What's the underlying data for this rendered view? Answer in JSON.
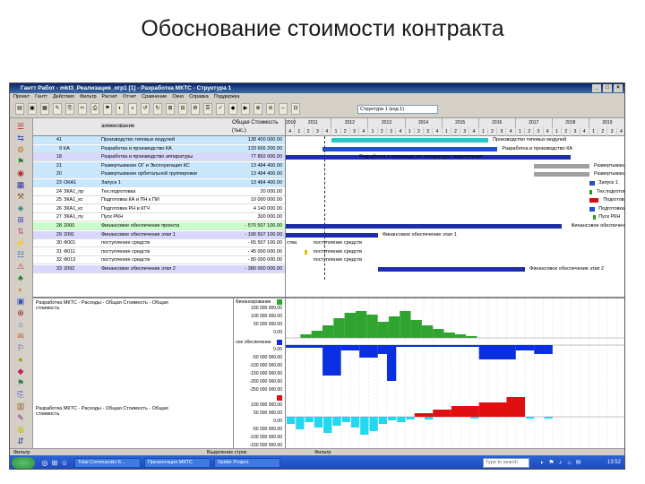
{
  "slide": {
    "title": "Обоснование стоимости контракта"
  },
  "window": {
    "title": "Гантт Работ - mkt3_Реализация_огр1 [1] - Разработка МКТС - Структура 1"
  },
  "menu": [
    "Проект",
    "Гантт",
    "Действия",
    "Фильтр",
    "Расчет",
    "Отчет",
    "Сравнение",
    "Окно",
    "Справка",
    "Поддержка"
  ],
  "toolbar": {
    "structure_combo": "Структура 1 (код 1)"
  },
  "grid": {
    "header_name": "аименование",
    "header_cost": "Общая Стоимость",
    "header_cost_unit": "(тыс.)",
    "rows": [
      {
        "num": "41",
        "code": "",
        "name": "Производство типовых модулей",
        "cost": "138 400 000.00"
      },
      {
        "num": "9",
        "code": "КА",
        "name": "Разработка и производство КА",
        "cost": "133 666 200.00"
      },
      {
        "num": "18",
        "code": "",
        "name": "Разработка и производство аппаратуры",
        "cost": "77 892 000.00"
      },
      {
        "num": "21",
        "code": "",
        "name": "Развертывание ОГ и Эксплуатация КС",
        "cost": "13 484 400.00"
      },
      {
        "num": "20",
        "code": "",
        "name": "Развертывание орбитальной группировки",
        "cost": "13 484 400.00"
      },
      {
        "num": "23",
        "code": "ОКА1",
        "name": "Запуск 1",
        "cost": "13 484 400.00"
      },
      {
        "num": "24",
        "code": "ЗКА1_пр",
        "name": "Тех.подготовка",
        "cost": "20 000.00"
      },
      {
        "num": "25",
        "code": "ЗКА1_кс",
        "name": "Подготовка КА и ПН к ПИ",
        "cost": "10 000 000.00"
      },
      {
        "num": "26",
        "code": "ЗКА1_кс",
        "name": "Подготовка РН и КГЧ",
        "cost": "4 140 000.00"
      },
      {
        "num": "27",
        "code": "ЗКА1_пу",
        "name": "Пуск РКН",
        "cost": "300 000.00"
      },
      {
        "num": "28",
        "code": "2000",
        "name": "Финансовое обеспечение проекта",
        "cost": "- 570 507 100.00"
      },
      {
        "num": "29",
        "code": "2091",
        "name": "Финансовое обеспечение этап 1",
        "cost": "- 190 507 100.00"
      },
      {
        "num": "30",
        "code": "Ф001",
        "name": "поступление средств",
        "cost": "- 65 507 100.00"
      },
      {
        "num": "31",
        "code": "Ф011",
        "name": "поступление средств",
        "cost": "- 45 000 000.00"
      },
      {
        "num": "32",
        "code": "Ф013",
        "name": "поступление средств",
        "cost": "- 80 000 000.00"
      },
      {
        "num": "33",
        "code": "2092",
        "name": "Финансовое обеспечение этап 2",
        "cost": "- 380 000 000.00"
      }
    ]
  },
  "timeline": {
    "years": [
      "2010",
      "2011",
      "2012",
      "2013",
      "2014",
      "2015",
      "2016",
      "2017",
      "2018",
      "2019"
    ],
    "quarters": [
      "4",
      "1",
      "2",
      "3",
      "4",
      "1",
      "2",
      "3",
      "4",
      "1",
      "2",
      "3",
      "4",
      "1",
      "2",
      "3",
      "4",
      "1",
      "2",
      "3",
      "4",
      "1",
      "2",
      "3",
      "4",
      "1",
      "2",
      "3",
      "4",
      "1",
      "2",
      "3",
      "4",
      "1",
      "2",
      "3",
      "4"
    ],
    "bar_labels": [
      "Производство типовых модулей",
      "Разработка и производство КА",
      "Разработка и производство аппаратуры подключения",
      "Развертывание ОГ и Эксплуатация КС",
      "Развертывание орбитальной группировки",
      "Запуск 1",
      "Тех.подготовка",
      "Подготовка КА и ПН к ПИ",
      "Подготовка РН и КГЧ",
      "Пуск РКН",
      "Финансовое обеспечение проекта",
      "Финансовое обеспечение этап 1",
      "поступление средств",
      "поступление средств",
      "поступление средств",
      "Финансовое обеспечение этап 2"
    ],
    "extra_label": "ства"
  },
  "lower": {
    "caption_top": "Разработка МКТС - Расходы - Общая Стоимость - Общая стоимость",
    "caption_bottom": "Разработка МКТС - Расходы - Общая Стоимость - Общая стоимость",
    "axis_top_label": "Финансирование",
    "axis_top_ticks": [
      "150 000 000.00",
      "100 000 000.00",
      "50 000 000.00",
      "0.00"
    ],
    "axis_mid_label": "ное обеспечение",
    "axis_mid_ticks": [
      "0.00",
      "-50 000 000.00",
      "-100 000 000.00",
      "-150 000 000.00",
      "-200 000 000.00",
      "-250 000 000.00"
    ],
    "axis_bot_ticks": [
      "100 000 000.00",
      "50 000 000.00",
      "0.00",
      "-50 000 000.00",
      "-100 000 000.00",
      "-150 000 000.00"
    ],
    "colors": {
      "green": "#2fa52f",
      "blue": "#0a2fe0",
      "red": "#e01010",
      "cyan": "#22d8f0"
    }
  },
  "status": {
    "left": "Фильтр",
    "mid": "Выделение строк",
    "right": "Фильтр"
  },
  "taskbar": {
    "items": [
      "Total Commander 6...",
      "Презентация МКТС",
      "Spider Project"
    ],
    "search": "Type to search",
    "clock": "13:52"
  }
}
